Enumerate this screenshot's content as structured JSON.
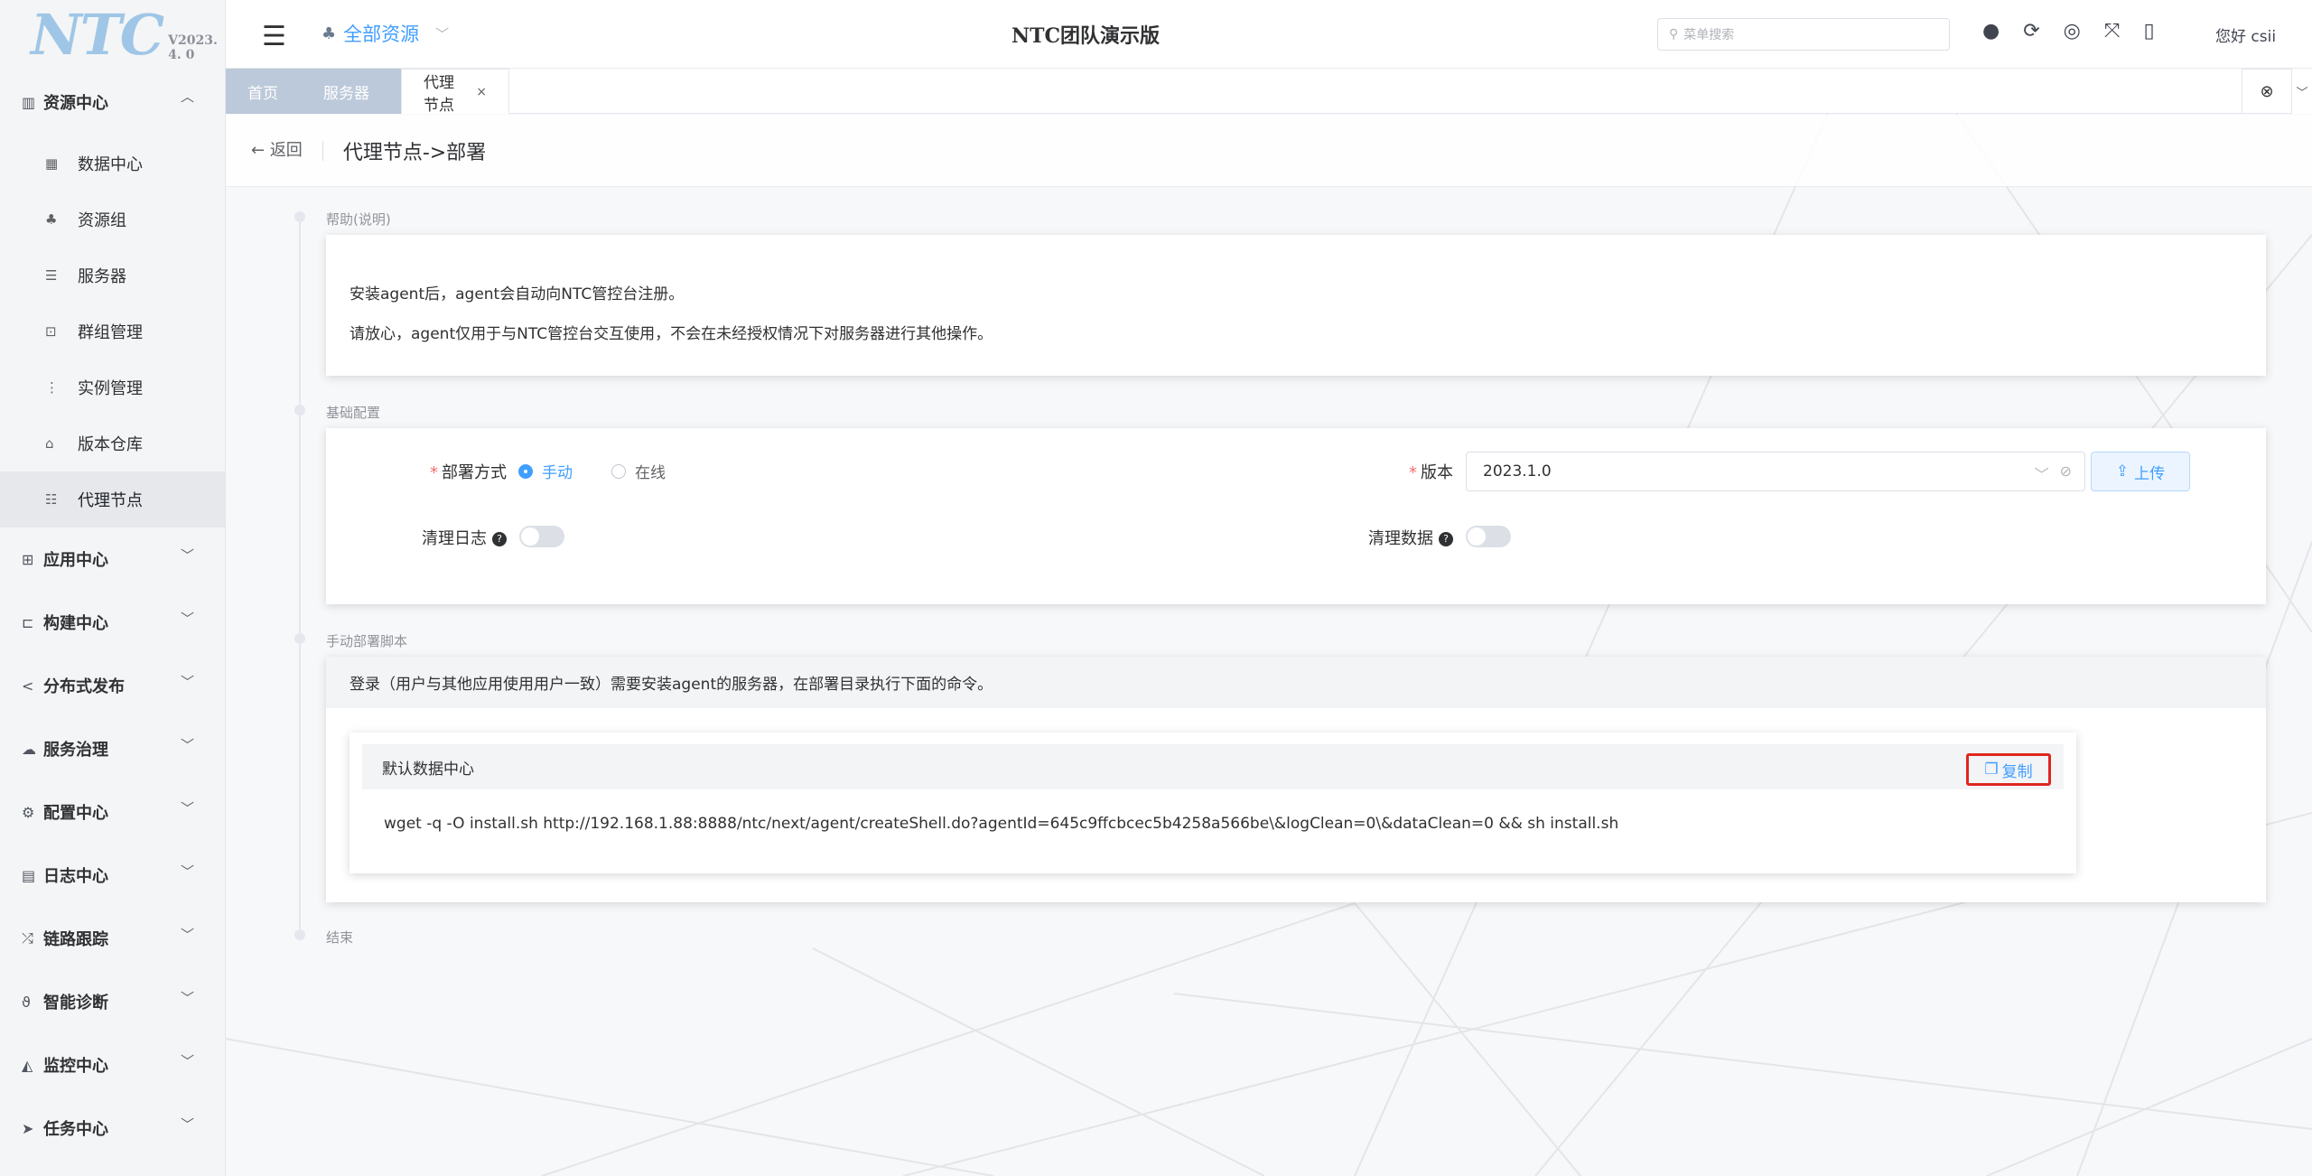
{
  "logo": {
    "text": "NTC",
    "version": "V2023. 4. 0"
  },
  "topbar": {
    "resource_selector": "全部资源",
    "center_title": "NTC团队演示版",
    "search_placeholder": "菜单搜索",
    "user": "您好 csii"
  },
  "sidebar": {
    "resource_center": "资源中心",
    "sub_items": [
      "数据中心",
      "资源组",
      "服务器",
      "群组管理",
      "实例管理",
      "版本仓库",
      "代理节点"
    ],
    "menus": [
      "应用中心",
      "构建中心",
      "分布式发布",
      "服务治理",
      "配置中心",
      "日志中心",
      "链路跟踪",
      "智能诊断",
      "监控中心",
      "任务中心"
    ]
  },
  "tabs": {
    "home": "首页",
    "servers": "服务器",
    "proxy": "代理节点"
  },
  "page": {
    "back": "返回",
    "title": "代理节点->部署"
  },
  "help": {
    "label": "帮助(说明)",
    "line1": "安装agent后，agent会自动向NTC管控台注册。",
    "line2": "请放心，agent仅用于与NTC管控台交互使用，不会在未经授权情况下对服务器进行其他操作。"
  },
  "basic": {
    "label": "基础配置",
    "deploy_mode_label": "部署方式",
    "mode_manual": "手动",
    "mode_online": "在线",
    "version_label": "版本",
    "version_value": "2023.1.0",
    "upload": "上传",
    "clean_log": "清理日志",
    "clean_data": "清理数据"
  },
  "manual": {
    "label": "手动部署脚本",
    "desc": "登录（用户与其他应用使用用户一致）需要安装agent的服务器，在部署目录执行下面的命令。",
    "datacenter": "默认数据中心",
    "copy": "复制",
    "command": "wget -q -O install.sh http://192.168.1.88:8888/ntc/next/agent/createShell.do?agentId=645c9ffcbcec5b4258a566be\\&logClean=0\\&dataClean=0 && sh install.sh"
  },
  "end_label": "结束"
}
